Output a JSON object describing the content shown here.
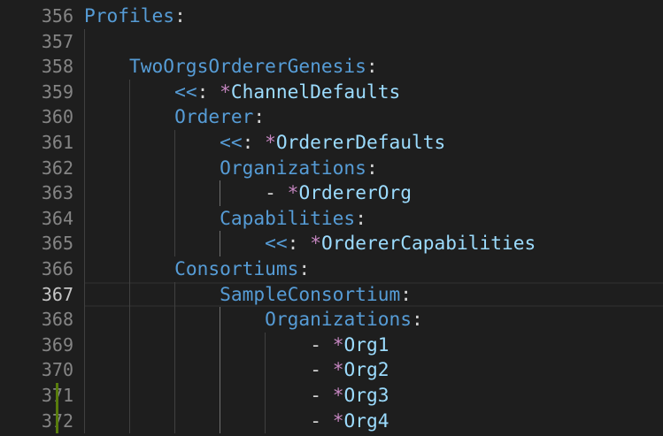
{
  "editor": {
    "language": "yaml",
    "current_line": 367,
    "colors": {
      "background": "#1e1e1e",
      "key": "#569cd6",
      "punctuation": "#d4d4d4",
      "alias_marker": "#c586c0",
      "alias": "#9cdcfe",
      "added_line_marker": "#587c0c"
    },
    "lines": [
      {
        "number": "356",
        "indent": 0,
        "tokens": [
          [
            "key",
            "Profiles"
          ],
          [
            "punct",
            ":"
          ]
        ]
      },
      {
        "number": "357",
        "indent": 0,
        "tokens": []
      },
      {
        "number": "358",
        "indent": 1,
        "tokens": [
          [
            "key",
            "TwoOrgsOrdererGenesis"
          ],
          [
            "punct",
            ":"
          ]
        ]
      },
      {
        "number": "359",
        "indent": 2,
        "tokens": [
          [
            "key",
            "<<"
          ],
          [
            "punct",
            ": "
          ],
          [
            "star",
            "*"
          ],
          [
            "alias",
            "ChannelDefaults"
          ]
        ]
      },
      {
        "number": "360",
        "indent": 2,
        "tokens": [
          [
            "key",
            "Orderer"
          ],
          [
            "punct",
            ":"
          ]
        ]
      },
      {
        "number": "361",
        "indent": 3,
        "tokens": [
          [
            "key",
            "<<"
          ],
          [
            "punct",
            ": "
          ],
          [
            "star",
            "*"
          ],
          [
            "alias",
            "OrdererDefaults"
          ]
        ]
      },
      {
        "number": "362",
        "indent": 3,
        "tokens": [
          [
            "key",
            "Organizations"
          ],
          [
            "punct",
            ":"
          ]
        ]
      },
      {
        "number": "363",
        "indent": 4,
        "tokens": [
          [
            "punct",
            "- "
          ],
          [
            "star",
            "*"
          ],
          [
            "alias",
            "OrdererOrg"
          ]
        ]
      },
      {
        "number": "364",
        "indent": 3,
        "tokens": [
          [
            "key",
            "Capabilities"
          ],
          [
            "punct",
            ":"
          ]
        ]
      },
      {
        "number": "365",
        "indent": 4,
        "tokens": [
          [
            "key",
            "<<"
          ],
          [
            "punct",
            ": "
          ],
          [
            "star",
            "*"
          ],
          [
            "alias",
            "OrdererCapabilities"
          ]
        ]
      },
      {
        "number": "366",
        "indent": 2,
        "tokens": [
          [
            "key",
            "Consortiums"
          ],
          [
            "punct",
            ":"
          ]
        ]
      },
      {
        "number": "367",
        "indent": 3,
        "tokens": [
          [
            "key",
            "SampleConsortium"
          ],
          [
            "punct",
            ":"
          ]
        ]
      },
      {
        "number": "368",
        "indent": 4,
        "tokens": [
          [
            "key",
            "Organizations"
          ],
          [
            "punct",
            ":"
          ]
        ]
      },
      {
        "number": "369",
        "indent": 5,
        "tokens": [
          [
            "punct",
            "- "
          ],
          [
            "star",
            "*"
          ],
          [
            "alias",
            "Org1"
          ]
        ]
      },
      {
        "number": "370",
        "indent": 5,
        "tokens": [
          [
            "punct",
            "- "
          ],
          [
            "star",
            "*"
          ],
          [
            "alias",
            "Org2"
          ]
        ]
      },
      {
        "number": "371",
        "indent": 5,
        "added": true,
        "tokens": [
          [
            "punct",
            "- "
          ],
          [
            "star",
            "*"
          ],
          [
            "alias",
            "Org3"
          ]
        ]
      },
      {
        "number": "372",
        "indent": 5,
        "added": true,
        "tokens": [
          [
            "punct",
            "- "
          ],
          [
            "star",
            "*"
          ],
          [
            "alias",
            "Org4"
          ]
        ]
      }
    ]
  }
}
